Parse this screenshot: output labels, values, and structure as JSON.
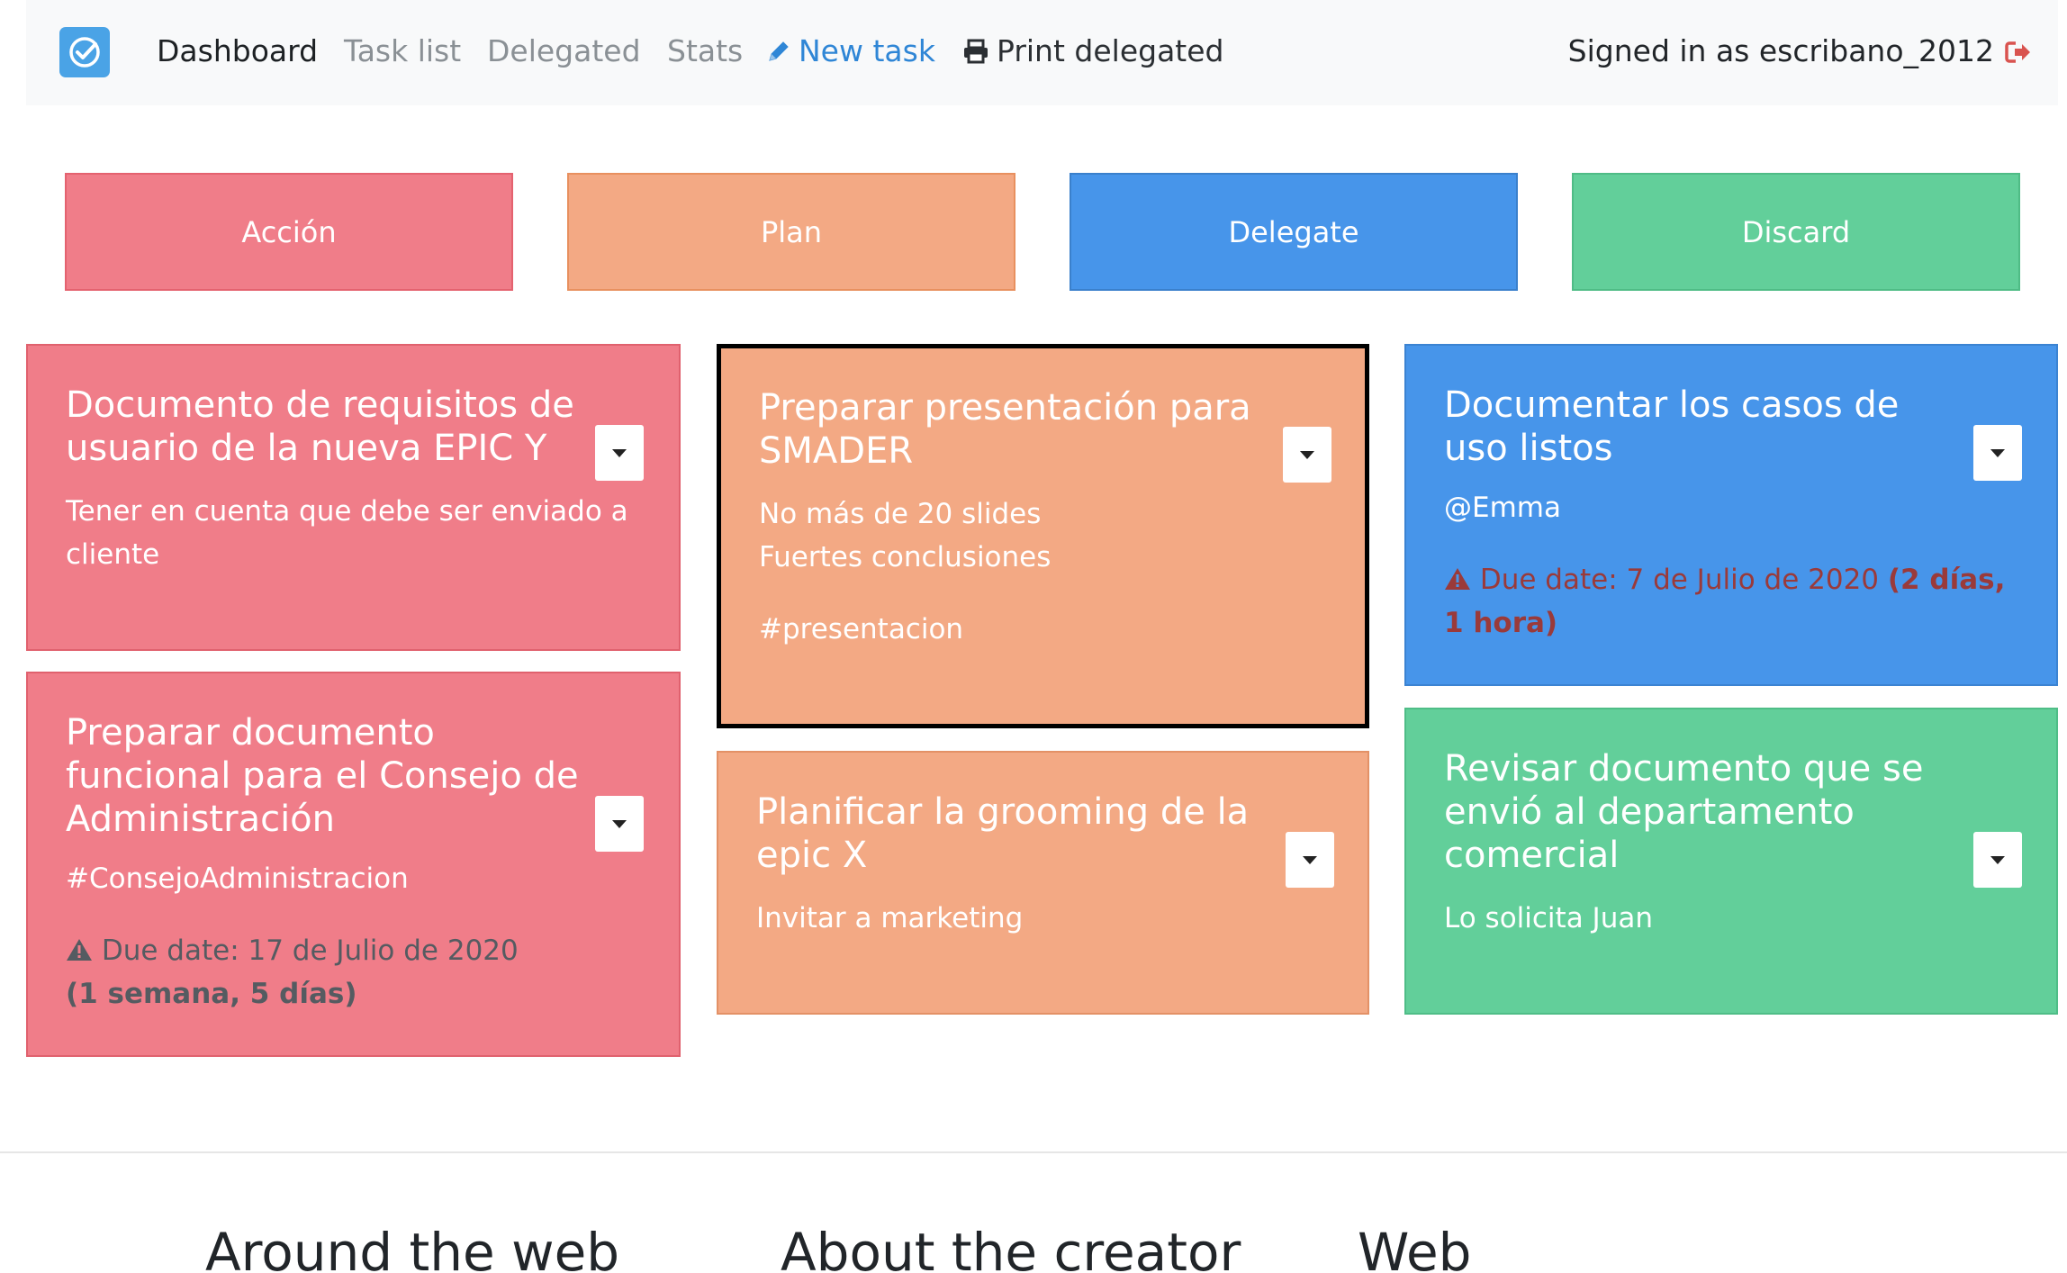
{
  "navbar": {
    "links": [
      "Dashboard",
      "Task list",
      "Delegated",
      "Stats"
    ],
    "new_task": "New task",
    "print": "Print delegated",
    "signed_in": "Signed in as escribano_2012"
  },
  "quadrants": [
    "Acción",
    "Plan",
    "Delegate",
    "Discard"
  ],
  "cards": [
    {
      "title": "Documento de requisitos de usuario de la nueva EPIC Y",
      "body": "Tener en cuenta que debe ser enviado a cliente"
    },
    {
      "title": "Preparar documento funcional para el Consejo de Administración",
      "tag": "#ConsejoAdministracion",
      "due": "Due date: 17 de Julio de 2020",
      "due_rel": "(1 semana, 5 días)"
    },
    {
      "title": "Preparar presentación para SMADER",
      "body": "No más de 20 slides\nFuertes conclusiones",
      "tag": "#presentacion"
    },
    {
      "title": "Planificar la grooming de la epic X",
      "body": "Invitar a marketing"
    },
    {
      "title": "Documentar los casos de uso listos",
      "body": "@Emma",
      "due": "Due date: 7 de Julio de 2020",
      "due_rel": "(2 días, 1 hora)"
    },
    {
      "title": "Revisar documento que se envió al departamento comercial",
      "body": "Lo solicita Juan"
    }
  ],
  "footer": {
    "headings": [
      "Around the web",
      "About the creator",
      "Web"
    ]
  },
  "colors": {
    "accion": "#f07d89",
    "plan": "#f3a984",
    "delegate": "#4795ea",
    "discard": "#62cf9a",
    "brand": "#4aa3e6",
    "link_primary": "#2f86d6",
    "logout": "#d9534f"
  }
}
